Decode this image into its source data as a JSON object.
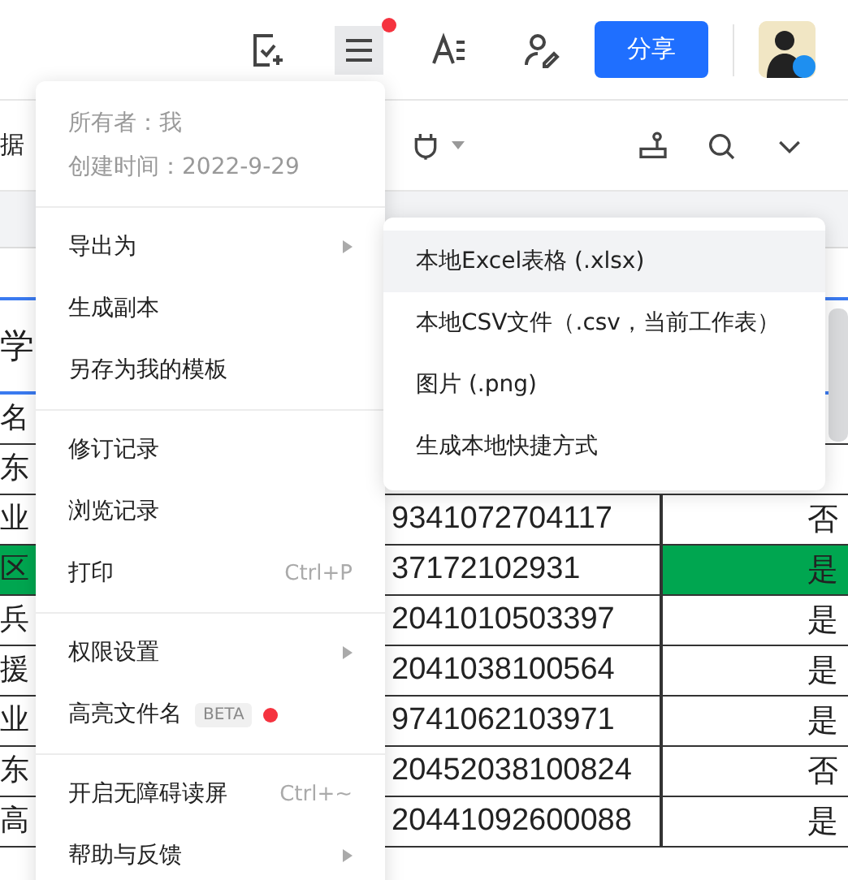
{
  "toolbar": {
    "menu_button_active": true,
    "menu_badge": true,
    "share_button": "分享"
  },
  "secondary_toolbar": {
    "partial_label": "据"
  },
  "sheet": {
    "rows": [
      {
        "kind": "title",
        "column_1": "学",
        "highlighted": false
      },
      {
        "kind": "row",
        "column_1": "名",
        "highlighted": false
      },
      {
        "kind": "row",
        "column_1": "东",
        "highlighted": false
      },
      {
        "kind": "row",
        "column_1": "业",
        "column_3": "9341072704117",
        "column_4": "否",
        "highlighted": false
      },
      {
        "kind": "row",
        "column_1": "区",
        "column_3": "37172102931",
        "column_4": "是",
        "highlighted": true
      },
      {
        "kind": "row",
        "column_1": "兵",
        "column_3": "2041010503397",
        "column_4": "是",
        "highlighted": false
      },
      {
        "kind": "row",
        "column_1": "援",
        "column_3": "2041038100564",
        "column_4": "是",
        "highlighted": false
      },
      {
        "kind": "row",
        "column_1": "业",
        "column_3": "9741062103971",
        "column_4": "是",
        "highlighted": false
      },
      {
        "kind": "row",
        "column_1": "东",
        "column_3": "20452038100824",
        "column_4": "否",
        "highlighted": false
      },
      {
        "kind": "row",
        "column_1": "高",
        "column_3": "20441092600088",
        "column_4": "是",
        "highlighted": false
      }
    ]
  },
  "menu": {
    "info": [
      "所有者：我",
      "创建时间：2022-9-29"
    ],
    "groups": [
      {
        "items": [
          {
            "label": "导出为",
            "has_submenu": true
          },
          {
            "label": "生成副本",
            "has_submenu": false
          },
          {
            "label": "另存为我的模板",
            "has_submenu": false
          }
        ]
      },
      {
        "items": [
          {
            "label": "修订记录",
            "has_submenu": false
          },
          {
            "label": "浏览记录",
            "has_submenu": false
          },
          {
            "label": "打印",
            "shortcut": "Ctrl+P",
            "has_submenu": false
          }
        ]
      },
      {
        "items": [
          {
            "label": "权限设置",
            "has_submenu": true
          },
          {
            "label": "高亮文件名",
            "badge": "BETA",
            "dot": true,
            "has_submenu": false
          }
        ]
      },
      {
        "items": [
          {
            "label": "开启无障碍读屏",
            "shortcut": "Ctrl+~",
            "has_submenu": false
          },
          {
            "label": "帮助与反馈",
            "has_submenu": true
          }
        ]
      }
    ]
  },
  "submenu": {
    "items": [
      {
        "label": "本地Excel表格 (.xlsx)",
        "selected": true
      },
      {
        "label": "本地CSV文件（.csv，当前工作表）",
        "selected": false
      },
      {
        "label": "图片 (.png)",
        "selected": false
      },
      {
        "label": "生成本地快捷方式",
        "selected": false
      }
    ]
  }
}
